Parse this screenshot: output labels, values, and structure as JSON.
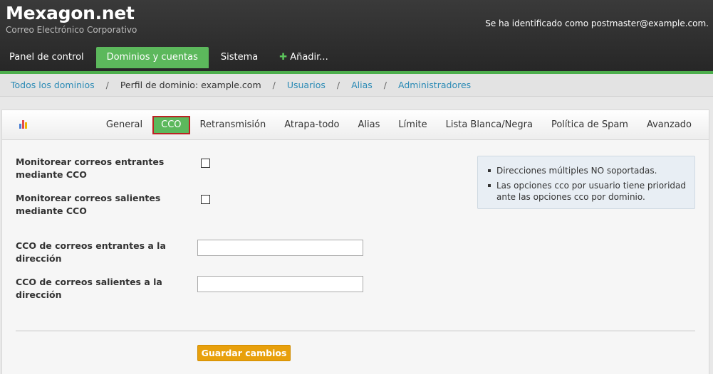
{
  "header": {
    "brand": "Mexagon.net",
    "tagline": "Correo Electrónico Corporativo",
    "identity": "Se ha identificado como postmaster@example.com."
  },
  "nav": {
    "items": [
      {
        "label": "Panel de control"
      },
      {
        "label": "Dominios y cuentas",
        "active": true
      },
      {
        "label": "Sistema"
      },
      {
        "label": "Añadir...",
        "icon": "plus-icon"
      }
    ]
  },
  "breadcrumb": {
    "items": [
      {
        "label": "Todos los dominios"
      },
      {
        "label": "Perfil de dominio: example.com"
      },
      {
        "label": "Usuarios"
      },
      {
        "label": "Alias"
      },
      {
        "label": "Administradores"
      }
    ],
    "separator": "/"
  },
  "tabs": {
    "items": [
      {
        "label": "General"
      },
      {
        "label": "CCO",
        "active": true
      },
      {
        "label": "Retransmisión"
      },
      {
        "label": "Atrapa-todo"
      },
      {
        "label": "Alias"
      },
      {
        "label": "Límite"
      },
      {
        "label": "Lista Blanca/Negra"
      },
      {
        "label": "Política de Spam"
      },
      {
        "label": "Avanzado"
      }
    ]
  },
  "form": {
    "monitor_incoming_label": "Monitorear correos entrantes mediante CCO",
    "monitor_incoming_checked": false,
    "monitor_outgoing_label": "Monitorear correos salientes mediante CCO",
    "monitor_outgoing_checked": false,
    "bcc_incoming_label": "CCO de correos entrantes a la dirección",
    "bcc_incoming_value": "",
    "bcc_outgoing_label": "CCO de correos salientes a la dirección",
    "bcc_outgoing_value": "",
    "save_label": "Guardar cambios"
  },
  "info": {
    "notes": [
      "Direcciones múltiples NO soportadas.",
      "Las opciones cco por usuario tiene prioridad ante las opciones cco por dominio."
    ]
  },
  "colors": {
    "nav_active": "#5cb85c",
    "link": "#2a8ab5",
    "save_button": "#e8a00c",
    "active_tab_border": "#bb2222"
  }
}
